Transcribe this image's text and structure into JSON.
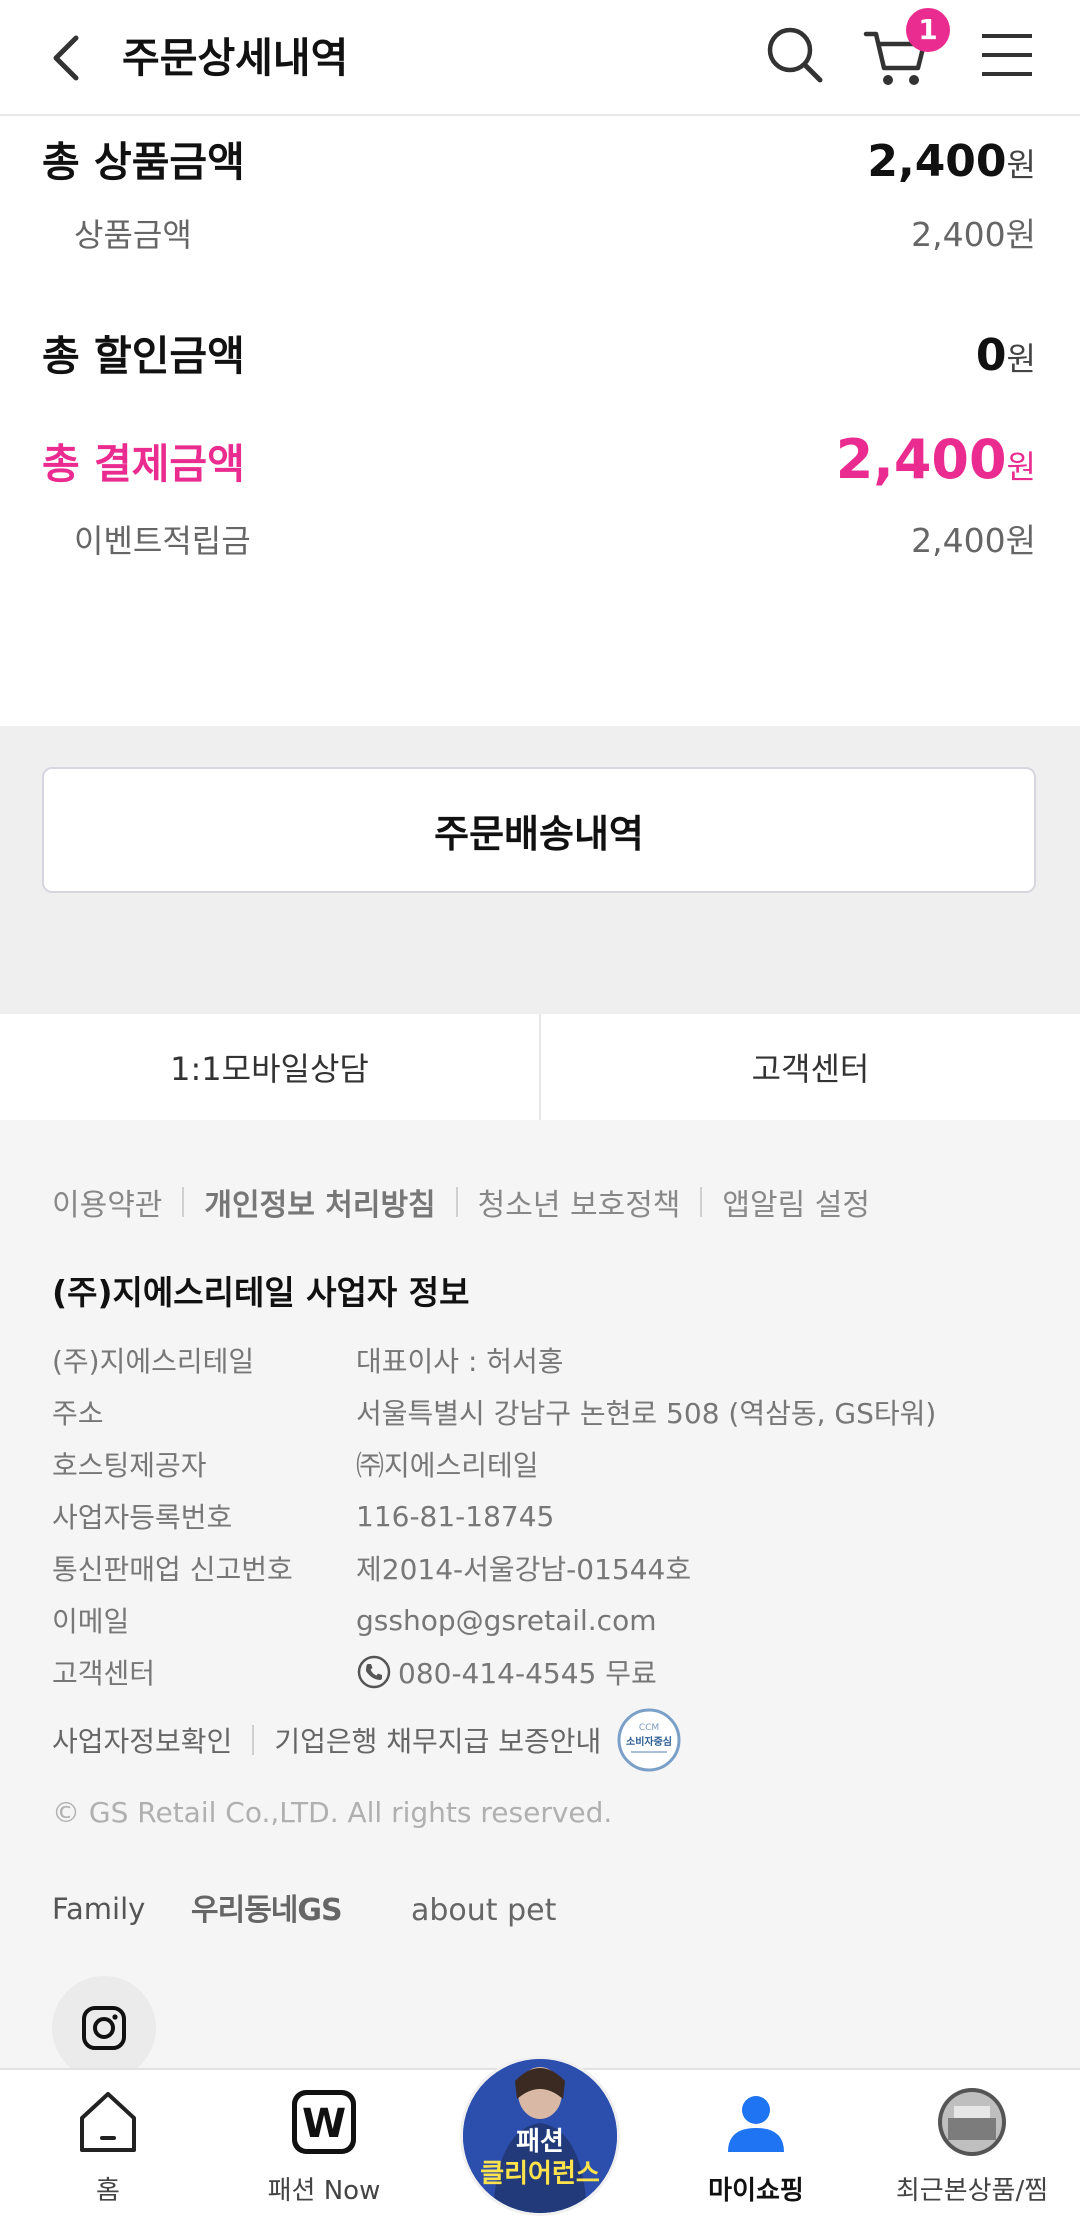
{
  "header": {
    "title": "주문상세내역",
    "cart_count": "1"
  },
  "summary": {
    "total_product_label": "총 상품금액",
    "total_product_value": "2,400",
    "product_label": "상품금액",
    "product_value": "2,400원",
    "total_discount_label": "총 할인금액",
    "total_discount_value": "0",
    "total_payment_label": "총 결제금액",
    "total_payment_value": "2,400",
    "event_points_label": "이벤트적립금",
    "event_points_value": "2,400원",
    "currency": "원"
  },
  "order_delivery_button": "주문배송내역",
  "cs_tabs": [
    "1:1모바일상담",
    "고객센터"
  ],
  "footer": {
    "links": [
      "이용약관",
      "개인정보 처리방침",
      "청소년 보호정책",
      "앱알림 설정"
    ],
    "company_title": "(주)지에스리테일 사업자 정보",
    "info": [
      {
        "k": "(주)지에스리테일",
        "v": "대표이사 : 허서홍"
      },
      {
        "k": "주소",
        "v": "서울특별시 강남구 논현로 508 (역삼동, GS타워)"
      },
      {
        "k": "호스팅제공자",
        "v": "㈜지에스리테일"
      },
      {
        "k": "사업자등록번호",
        "v": "116-81-18745"
      },
      {
        "k": "통신판매업 신고번호",
        "v": "제2014-서울강남-01544호"
      },
      {
        "k": "이메일",
        "v": "gsshop@gsretail.com"
      },
      {
        "k": "고객센터",
        "v": "080-414-4545 무료"
      }
    ],
    "bottom_links": [
      "사업자정보확인",
      "기업은행 채무지급 보증안내"
    ],
    "ccm_badge": "소비자중심",
    "copyright": "© GS Retail Co.,LTD. All rights reserved.",
    "family_label": "Family",
    "family_brands": [
      "우리동네GS",
      "about pet"
    ]
  },
  "bottom_nav": {
    "items": [
      "홈",
      "패션 Now",
      "마이쇼핑",
      "최근본상품/찜"
    ],
    "promo_line1": "패션",
    "promo_line2": "클리어런스"
  },
  "colors": {
    "accent": "#ea2b8f",
    "footer_bg": "#f5f5f5",
    "grey_band": "#efefef"
  }
}
